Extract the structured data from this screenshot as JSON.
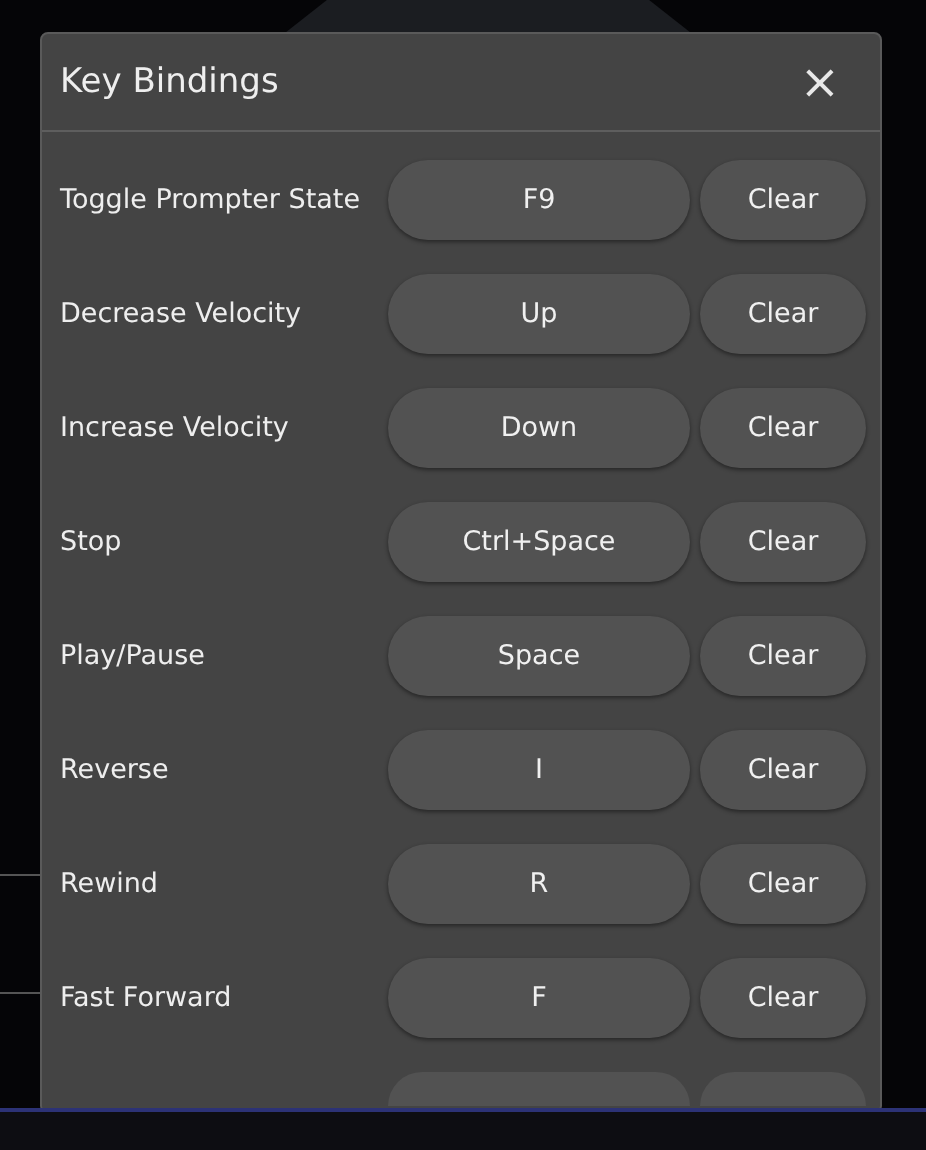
{
  "dialog": {
    "title": "Key Bindings",
    "close": "×"
  },
  "bindings": [
    {
      "action": "Toggle Prompter State",
      "key": "F9",
      "clear": "Clear"
    },
    {
      "action": "Decrease Velocity",
      "key": "Up",
      "clear": "Clear"
    },
    {
      "action": "Increase Velocity",
      "key": "Down",
      "clear": "Clear"
    },
    {
      "action": "Stop",
      "key": "Ctrl+Space",
      "clear": "Clear"
    },
    {
      "action": "Play/Pause",
      "key": "Space",
      "clear": "Clear"
    },
    {
      "action": "Reverse",
      "key": "I",
      "clear": "Clear"
    },
    {
      "action": "Rewind",
      "key": "R",
      "clear": "Clear"
    },
    {
      "action": "Fast Forward",
      "key": "F",
      "clear": "Clear"
    }
  ]
}
